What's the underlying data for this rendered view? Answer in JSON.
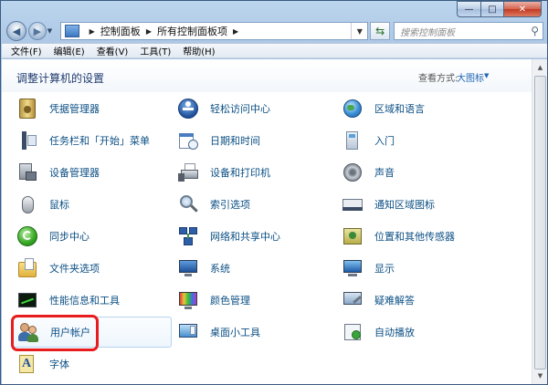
{
  "titlebar": {
    "minimize": "—",
    "maximize": "□",
    "close": "✕"
  },
  "nav": {
    "back_icon": "back-arrow-icon",
    "forward_icon": "forward-arrow-icon",
    "breadcrumb": [
      "控制面板",
      "所有控制面板项"
    ],
    "search_placeholder": "搜索控制面板"
  },
  "menu": [
    "文件(F)",
    "编辑(E)",
    "查看(V)",
    "工具(T)",
    "帮助(H)"
  ],
  "page": {
    "title": "调整计算机的设置",
    "view_label": "查看方式:",
    "view_value": "大图标"
  },
  "columns": [
    [
      {
        "label": "凭据管理器",
        "icon": "credential-vault-icon"
      },
      {
        "label": "任务栏和「开始」菜单",
        "icon": "taskbar-icon"
      },
      {
        "label": "设备管理器",
        "icon": "device-manager-icon"
      },
      {
        "label": "鼠标",
        "icon": "mouse-icon"
      },
      {
        "label": "同步中心",
        "icon": "sync-icon"
      },
      {
        "label": "文件夹选项",
        "icon": "folder-options-icon"
      },
      {
        "label": "性能信息和工具",
        "icon": "performance-icon"
      },
      {
        "label": "用户帐户",
        "icon": "user-accounts-icon"
      },
      {
        "label": "字体",
        "icon": "fonts-icon"
      }
    ],
    [
      {
        "label": "轻松访问中心",
        "icon": "ease-of-access-icon"
      },
      {
        "label": "日期和时间",
        "icon": "calendar-clock-icon"
      },
      {
        "label": "设备和打印机",
        "icon": "printer-icon"
      },
      {
        "label": "索引选项",
        "icon": "magnifier-icon"
      },
      {
        "label": "网络和共享中心",
        "icon": "network-icon"
      },
      {
        "label": "系统",
        "icon": "system-icon"
      },
      {
        "label": "颜色管理",
        "icon": "color-management-icon"
      },
      {
        "label": "桌面小工具",
        "icon": "gadgets-icon"
      }
    ],
    [
      {
        "label": "区域和语言",
        "icon": "globe-icon"
      },
      {
        "label": "入门",
        "icon": "getting-started-icon"
      },
      {
        "label": "声音",
        "icon": "speaker-icon"
      },
      {
        "label": "通知区域图标",
        "icon": "notification-area-icon"
      },
      {
        "label": "位置和其他传感器",
        "icon": "location-sensor-icon"
      },
      {
        "label": "显示",
        "icon": "display-icon"
      },
      {
        "label": "疑难解答",
        "icon": "troubleshooting-icon"
      },
      {
        "label": "自动播放",
        "icon": "autoplay-icon"
      }
    ]
  ],
  "selected_item": "用户帐户",
  "colors": {
    "link": "#0b4f84",
    "highlight_box": "#e81c1c",
    "title": "#1e3a6e"
  }
}
